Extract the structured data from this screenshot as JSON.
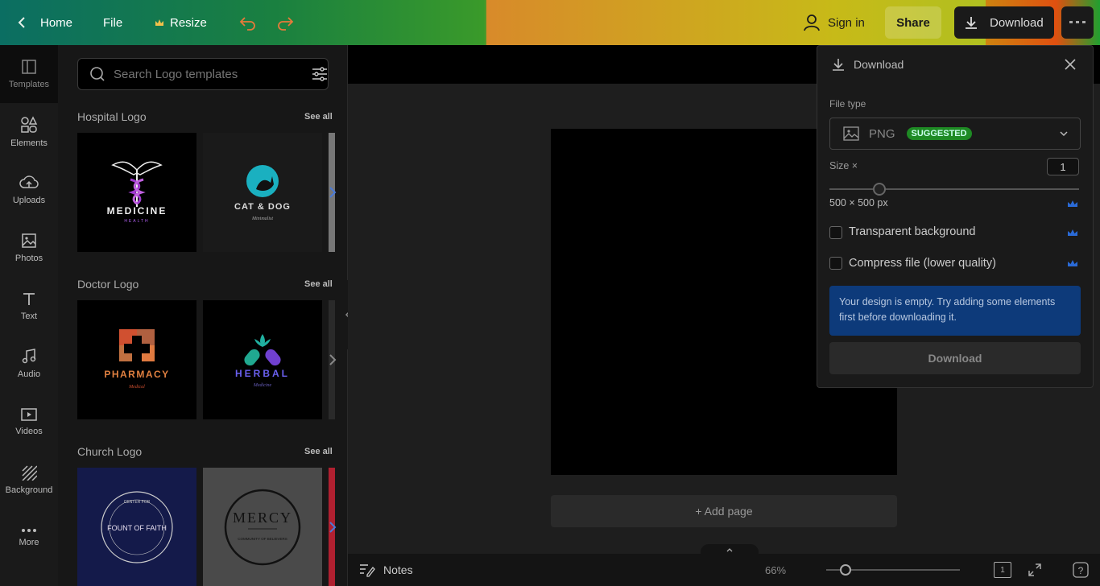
{
  "topbar": {
    "home_label": "Home",
    "file_label": "File",
    "resize_label": "Resize",
    "sign_in_label": "Sign in",
    "share_label": "Share",
    "download_label": "Download"
  },
  "rail": {
    "items": [
      {
        "label": "Templates",
        "icon": "templates-icon"
      },
      {
        "label": "Elements",
        "icon": "elements-icon"
      },
      {
        "label": "Uploads",
        "icon": "upload-cloud-icon"
      },
      {
        "label": "Photos",
        "icon": "photo-icon"
      },
      {
        "label": "Text",
        "icon": "text-icon"
      },
      {
        "label": "Audio",
        "icon": "music-note-icon"
      },
      {
        "label": "Videos",
        "icon": "video-icon"
      },
      {
        "label": "Background",
        "icon": "background-hatch-icon"
      },
      {
        "label": "More",
        "icon": "more-dots-icon"
      }
    ]
  },
  "panel": {
    "search_placeholder": "Search Logo templates",
    "see_all_label": "See all",
    "sections": [
      {
        "title": "Hospital Logo",
        "thumbs": [
          {
            "line1": "MEDICINE",
            "line2": "HEALTH"
          },
          {
            "line1": "CAT & DOG",
            "line2": "Minimalist"
          }
        ]
      },
      {
        "title": "Doctor Logo",
        "thumbs": [
          {
            "line1": "PHARMACY",
            "line2": "Medical"
          },
          {
            "line1": "HERBAL",
            "line2": "Medicine"
          }
        ]
      },
      {
        "title": "Church Logo",
        "thumbs": [
          {
            "line1": "FOUNT OF FAITH",
            "line2": "CENTER FOR"
          },
          {
            "line1": "MERCY",
            "line2": "COMMUNITY OF BELIEVERS"
          }
        ]
      }
    ]
  },
  "canvas": {
    "add_page_label": "+ Add page"
  },
  "bottombar": {
    "notes_label": "Notes",
    "zoom_label": "66%",
    "zoom_level": 0.1,
    "page_count": "1"
  },
  "download_panel": {
    "title": "Download",
    "file_type_label": "File type",
    "file_type_value": "PNG",
    "suggested_badge": "SUGGESTED",
    "size_label": "Size ×",
    "size_value": "1",
    "size_px_label": "500 × 500 px",
    "transparent_label": "Transparent background",
    "compress_label": "Compress file (lower quality)",
    "info_text": "Your design is empty. Try adding some elements first before downloading it.",
    "download_button": "Download"
  },
  "colors": {
    "badge_green": "#1e8a24",
    "info_blue": "#0d3a7a",
    "crown_blue": "#2a6ad6"
  }
}
